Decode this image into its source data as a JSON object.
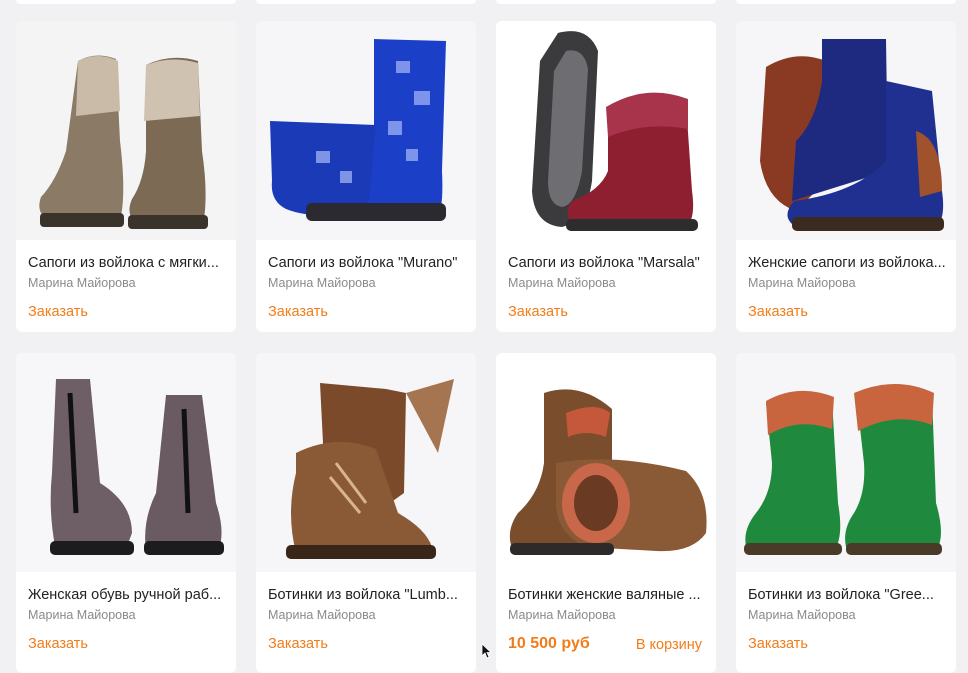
{
  "products": [
    {
      "title": "Сапоги из войлока с мягки...",
      "seller": "Марина Майорова",
      "action": "Заказать"
    },
    {
      "title": "Сапоги из войлока \"Murano\"",
      "seller": "Марина Майорова",
      "action": "Заказать"
    },
    {
      "title": "Сапоги из войлока \"Marsala\"",
      "seller": "Марина Майорова",
      "action": "Заказать"
    },
    {
      "title": "Женские сапоги из войлока...",
      "seller": "Марина Майорова",
      "action": "Заказать"
    },
    {
      "title": "Женская обувь ручной раб...",
      "seller": "Марина Майорова",
      "action": "Заказать"
    },
    {
      "title": "Ботинки из войлока \"Lumb...",
      "seller": "Марина Майорова",
      "action": "Заказать"
    },
    {
      "title": "Ботинки женские валяные ...",
      "seller": "Марина Майорова",
      "price": "10 500 руб",
      "action": "В корзину"
    },
    {
      "title": "Ботинки из войлока \"Gree...",
      "seller": "Марина Майорова",
      "action": "Заказать"
    }
  ],
  "colors": {
    "accent": "#f07d1a",
    "background": "#f1f0f3"
  }
}
